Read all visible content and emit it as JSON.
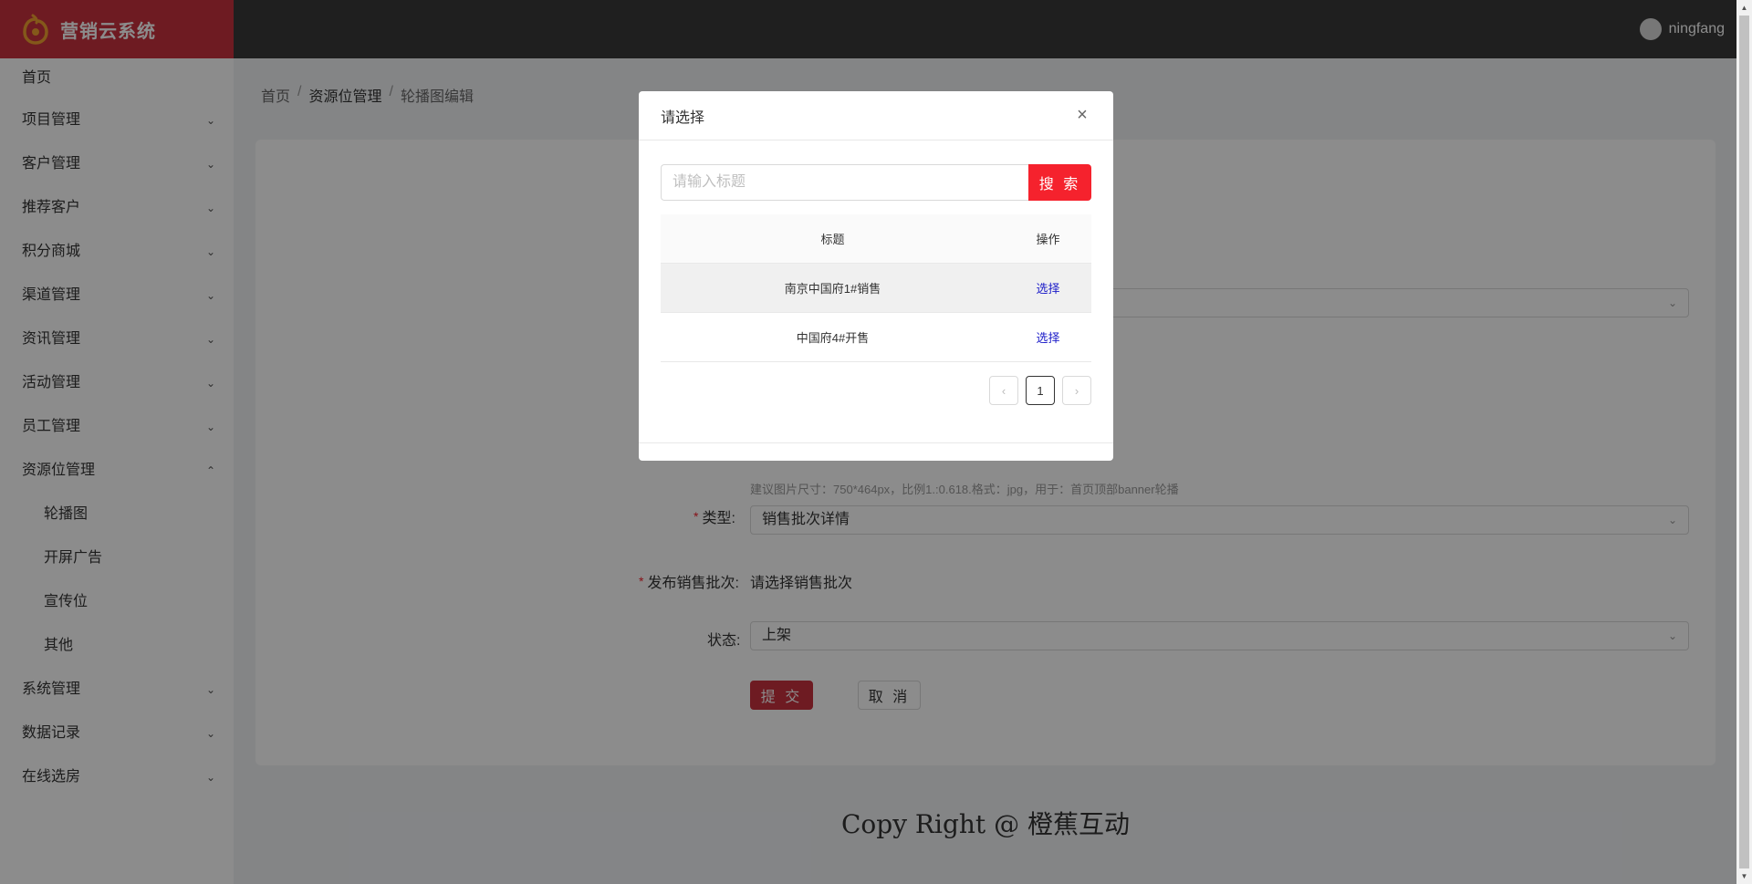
{
  "app": {
    "title": "营销云系统"
  },
  "header": {
    "username": "ningfang"
  },
  "sidebar": {
    "items": [
      {
        "label": "首页",
        "chevron": ""
      },
      {
        "label": "项目管理",
        "chevron": "⌄"
      },
      {
        "label": "客户管理",
        "chevron": "⌄"
      },
      {
        "label": "推荐客户",
        "chevron": "⌄"
      },
      {
        "label": "积分商城",
        "chevron": "⌄"
      },
      {
        "label": "渠道管理",
        "chevron": "⌄"
      },
      {
        "label": "资讯管理",
        "chevron": "⌄"
      },
      {
        "label": "活动管理",
        "chevron": "⌄"
      },
      {
        "label": "员工管理",
        "chevron": "⌄"
      },
      {
        "label": "资源位管理",
        "chevron": "⌃"
      },
      {
        "label": "系统管理",
        "chevron": "⌄"
      },
      {
        "label": "数据记录",
        "chevron": "⌄"
      },
      {
        "label": "在线选房",
        "chevron": "⌄"
      }
    ],
    "sub_items": [
      "轮播图",
      "开屏广告",
      "宣传位",
      "其他"
    ]
  },
  "breadcrumb": {
    "home": "首页",
    "section": "资源位管理",
    "current": "轮播图编辑",
    "sep": "/"
  },
  "form": {
    "hint": "建议图片尺寸：750*464px，比例1.:0.618.格式：jpg，用于：首页顶部banner轮播",
    "type_label": "类型:",
    "type_value": "销售批次详情",
    "batch_label": "发布销售批次:",
    "batch_value": "请选择销售批次",
    "status_label": "状态:",
    "status_value": "上架",
    "required_mark": "*",
    "submit_label": "提 交",
    "cancel_label": "取 消"
  },
  "footer": {
    "text": "Copy Right @ 橙蕉互动"
  },
  "modal": {
    "title": "请选择",
    "close": "×",
    "search_placeholder": "请输入标题",
    "search_label": "搜 索",
    "columns": {
      "title": "标题",
      "op": "操作"
    },
    "rows": [
      {
        "title": "南京中国府1#销售",
        "op": "选择"
      },
      {
        "title": "中国府4#开售",
        "op": "选择"
      }
    ],
    "pager": {
      "prev": "‹",
      "page": "1",
      "next": "›"
    }
  },
  "colors": {
    "brand": "#c8323e",
    "search_button": "#f5222d",
    "header": "#3a3a3a",
    "link": "#1a1ac8"
  }
}
